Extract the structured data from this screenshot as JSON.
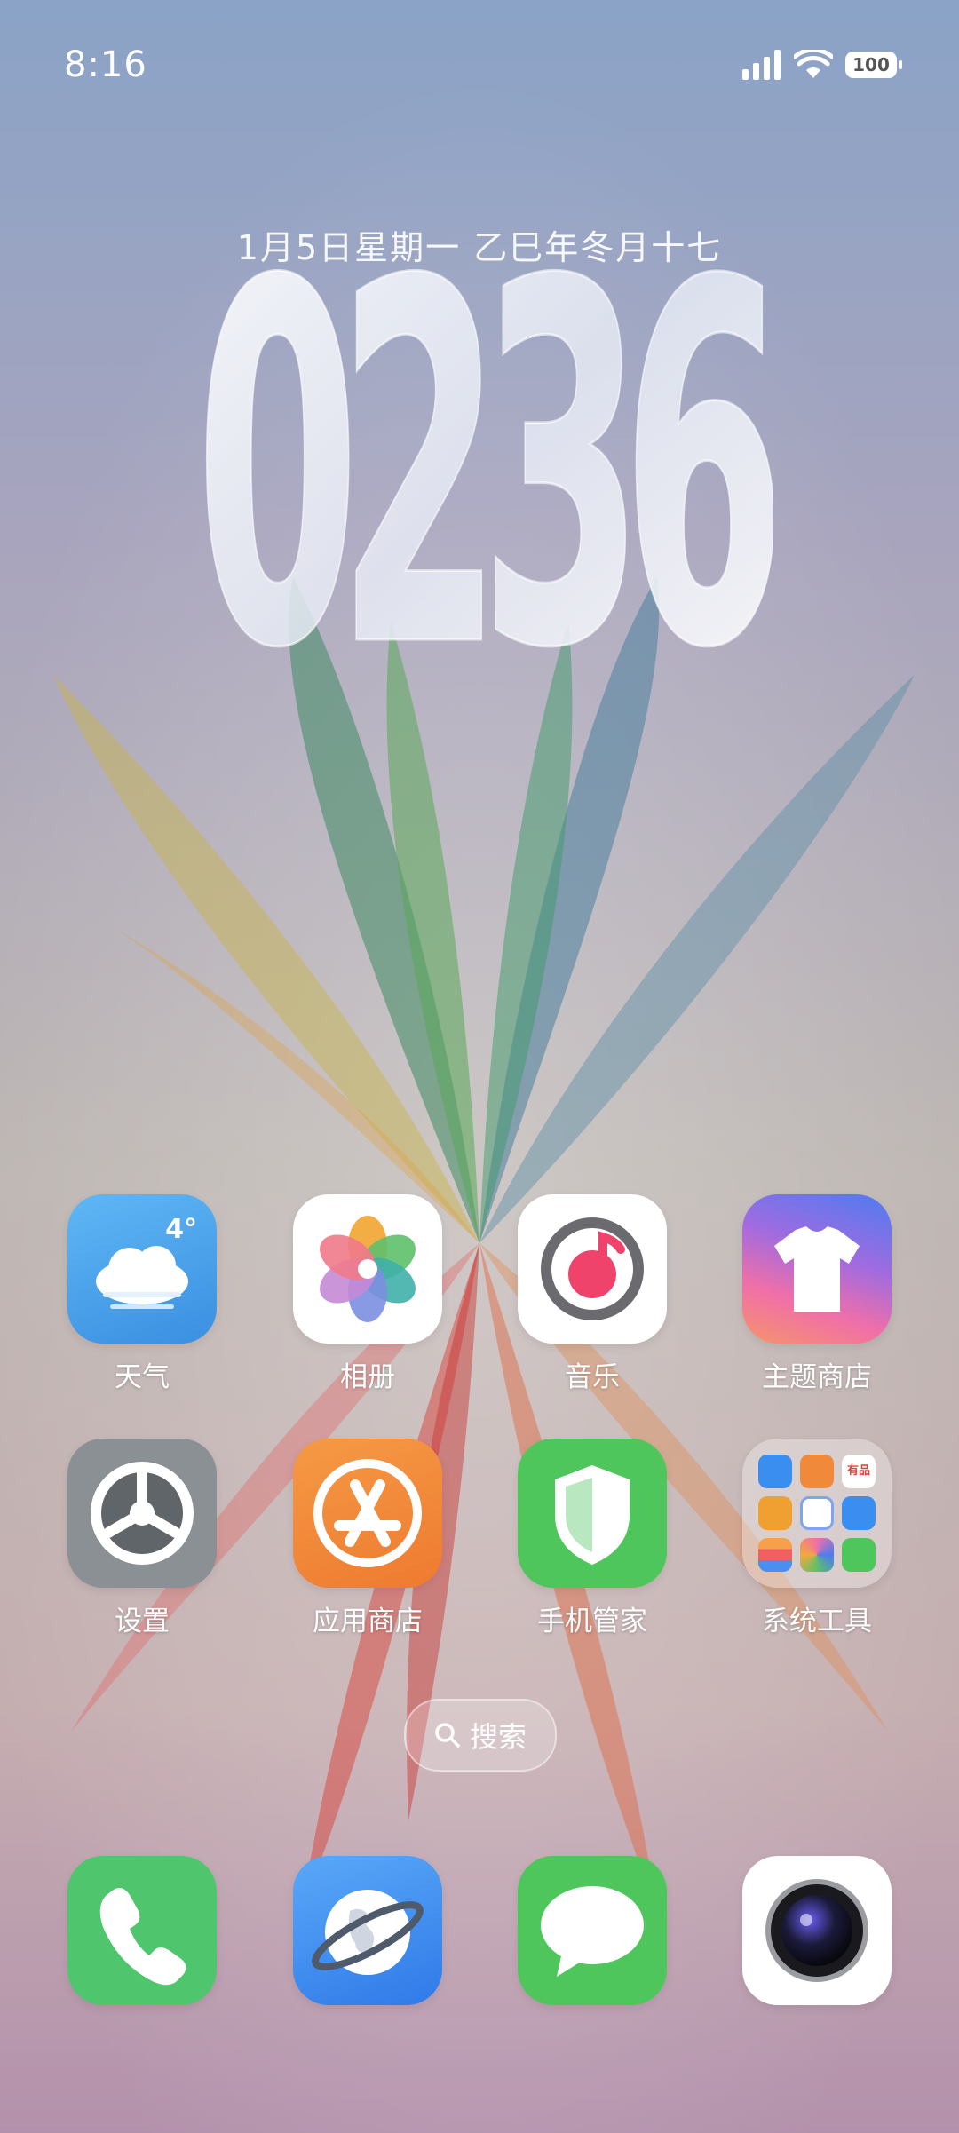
{
  "status_bar": {
    "time": "8:16",
    "battery": "100",
    "icons": [
      "signal-icon",
      "wifi-icon",
      "battery-icon"
    ]
  },
  "clock_widget": {
    "date": "1月5日星期一 乙巳年冬月十七",
    "time_digits": "0236"
  },
  "apps": {
    "row1": [
      {
        "label": "天气",
        "icon": "weather-icon",
        "temp": "4°"
      },
      {
        "label": "相册",
        "icon": "gallery-icon"
      },
      {
        "label": "音乐",
        "icon": "music-icon"
      },
      {
        "label": "主题商店",
        "icon": "theme-store-icon"
      }
    ],
    "row2": [
      {
        "label": "设置",
        "icon": "settings-icon"
      },
      {
        "label": "应用商店",
        "icon": "app-store-icon"
      },
      {
        "label": "手机管家",
        "icon": "phone-manager-icon"
      },
      {
        "label": "系统工具",
        "icon": "system-tools-folder-icon",
        "mini_badge": "有品"
      }
    ]
  },
  "search": {
    "label": "搜索"
  },
  "dock": [
    {
      "icon": "phone-icon"
    },
    {
      "icon": "browser-icon"
    },
    {
      "icon": "messages-icon"
    },
    {
      "icon": "camera-icon"
    }
  ],
  "colors": {
    "weather_bg": "#4aa0ea",
    "music_accent": "#f0436b",
    "theme_store_gradient": [
      "#f06fa8",
      "#4d7cf0"
    ],
    "settings_bg": "#8a9094",
    "app_store_bg": "#f08a3a",
    "phone_manager_bg": "#4fc65c",
    "phone_bg": "#4fc66e",
    "browser_bg": "#3d8bf0",
    "messages_bg": "#4fc65c"
  }
}
